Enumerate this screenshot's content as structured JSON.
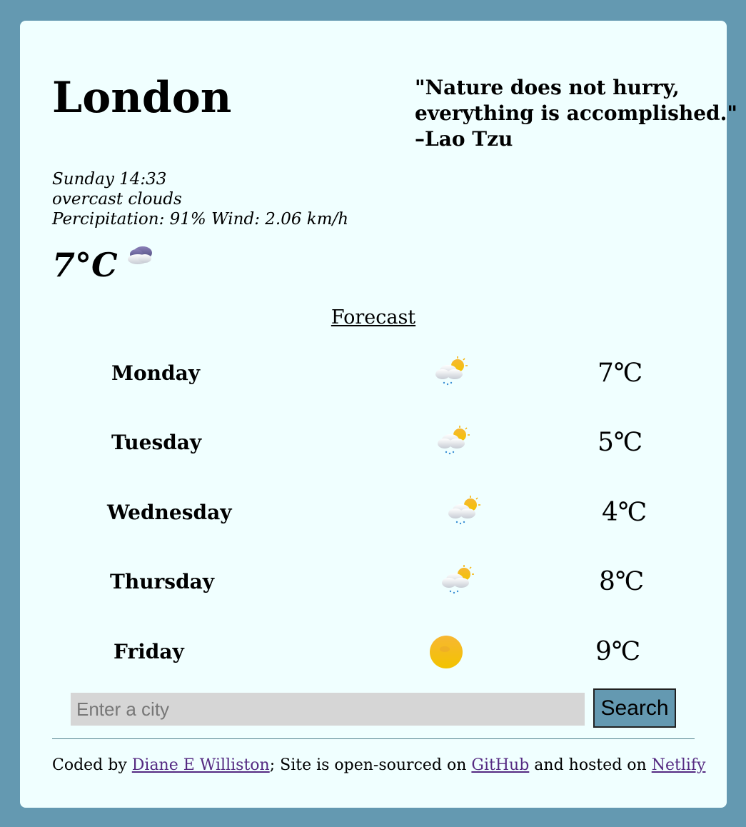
{
  "city": "London",
  "quote": {
    "line1": "\"Nature does not hurry,",
    "line2": "everything is accomplished.\"",
    "author": "–Lao Tzu"
  },
  "current": {
    "datetime": "Sunday 14:33",
    "description": "overcast clouds",
    "precipitation_wind": "Percipitation: 91% Wind: 2.06 km/h",
    "temperature": "7°C",
    "icon": "cloudy-night-icon"
  },
  "forecast": {
    "title": "Forecast",
    "days": [
      {
        "day": "Monday",
        "temp": "7℃",
        "icon": "sun-cloud-rain-icon"
      },
      {
        "day": "Tuesday",
        "temp": "5℃",
        "icon": "sun-cloud-rain-icon"
      },
      {
        "day": "Wednesday",
        "temp": "4℃",
        "icon": "sun-cloud-rain-icon"
      },
      {
        "day": "Thursday",
        "temp": "8℃",
        "icon": "sun-cloud-rain-icon"
      },
      {
        "day": "Friday",
        "temp": "9℃",
        "icon": "sun-icon"
      }
    ]
  },
  "search": {
    "placeholder": "Enter a city",
    "value": "",
    "button_label": "Search"
  },
  "footer": {
    "coded_by": "Coded by ",
    "author_link": "Diane E Williston",
    "middle": "; Site is open-sourced on ",
    "github_link": "GitHub",
    "hosted": " and hosted on ",
    "netlify_link": "Netlify"
  },
  "colors": {
    "page_background": "#6499b1",
    "card_background": "#f0ffff",
    "search_button": "#6499b1",
    "link": "#552a82"
  }
}
